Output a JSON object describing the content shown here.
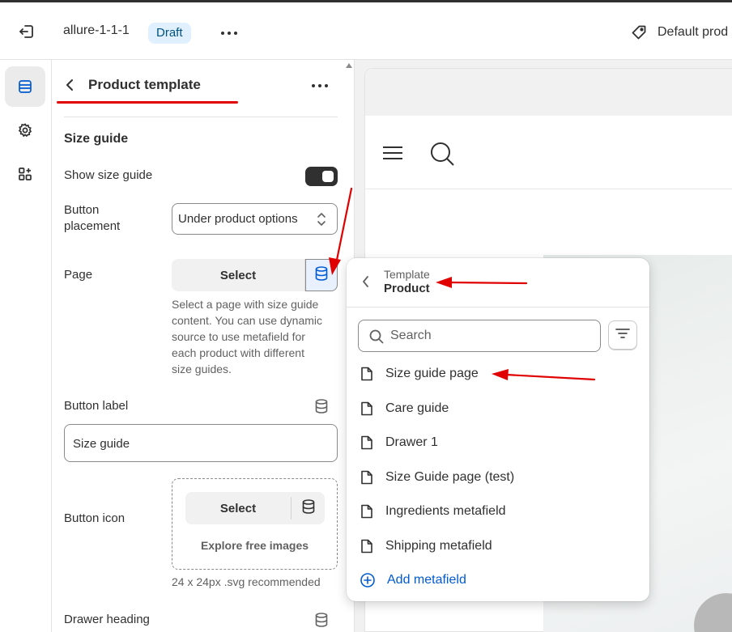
{
  "topbar": {
    "exit_icon": "exit-icon",
    "theme_name": "allure-1-1-1",
    "status_badge": "Draft",
    "more_icon": "more-horizontal-icon",
    "template_label": "Default prod",
    "tag_icon": "tag-icon"
  },
  "rail": {
    "items": [
      {
        "icon": "sections-icon",
        "active": true
      },
      {
        "icon": "gear-icon",
        "active": false
      },
      {
        "icon": "apps-icon",
        "active": false
      }
    ]
  },
  "panel": {
    "title": "Product template",
    "section_heading": "Size guide",
    "show_size_guide": {
      "label": "Show size guide",
      "checked": true
    },
    "button_placement": {
      "label_line1": "Button",
      "label_line2": "placement",
      "value": "Under product options"
    },
    "page": {
      "label": "Page",
      "select_label": "Select",
      "help_lines": [
        "Select a page with size guide",
        "content. You can use dynamic",
        "source to use metafield for",
        "each product with different",
        "size guides."
      ]
    },
    "button_label": {
      "label": "Button label",
      "value": "Size guide"
    },
    "button_icon": {
      "label": "Button icon",
      "select_label": "Select",
      "explore": "Explore free images",
      "hint": "24 x 24px .svg recommended"
    },
    "drawer_heading": {
      "label": "Drawer heading"
    }
  },
  "popover": {
    "breadcrumb_small": "Template",
    "breadcrumb_title": "Product",
    "search_placeholder": "Search",
    "items": [
      {
        "label": "Size guide page"
      },
      {
        "label": "Care guide"
      },
      {
        "label": "Drawer 1"
      },
      {
        "label": "Size Guide page (test)"
      },
      {
        "label": "Ingredients metafield"
      },
      {
        "label": "Shipping metafield"
      }
    ],
    "add_label": "Add metafield"
  },
  "colors": {
    "annotation_red": "#e00000",
    "accent_blue": "#005bd3",
    "badge_bg": "#e0f0ff",
    "badge_text": "#00527c"
  }
}
